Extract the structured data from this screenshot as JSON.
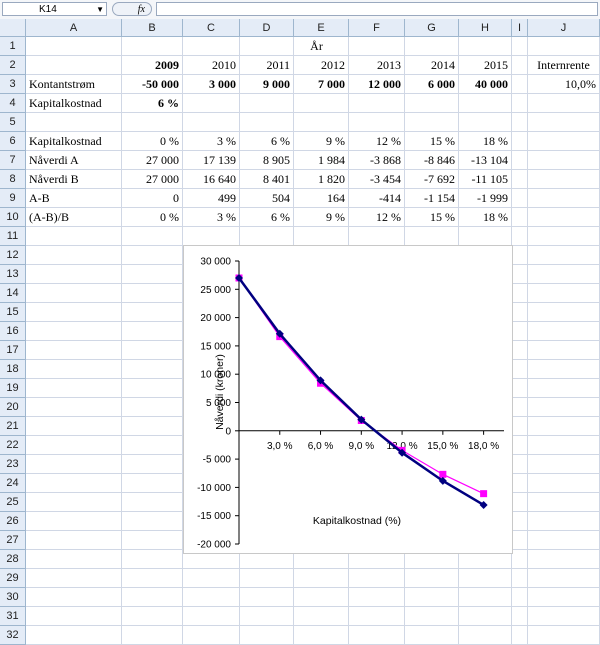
{
  "formula_bar": {
    "name_box": "K14",
    "fx": "fx",
    "formula": ""
  },
  "columns": [
    "A",
    "B",
    "C",
    "D",
    "E",
    "F",
    "G",
    "H",
    "I",
    "J"
  ],
  "rows": [
    "1",
    "2",
    "3",
    "4",
    "5",
    "6",
    "7",
    "8",
    "9",
    "10",
    "11",
    "12",
    "13",
    "14",
    "15",
    "16",
    "17",
    "18",
    "19",
    "20",
    "21",
    "22",
    "23",
    "24",
    "25",
    "26",
    "27",
    "28",
    "29",
    "30",
    "31",
    "32"
  ],
  "cells": {
    "aar": "År",
    "years": [
      "2009",
      "2010",
      "2011",
      "2012",
      "2013",
      "2014",
      "2015"
    ],
    "internrente_label": "Internrente",
    "internrente_value": "10,0%",
    "row3_label": "Kontantstrøm",
    "row3_values": [
      "-50 000",
      "3 000",
      "9 000",
      "7 000",
      "12 000",
      "6 000",
      "40 000"
    ],
    "row4_label": "Kapitalkostnad",
    "row4_value": "6 %",
    "row6_label": "Kapitalkostnad",
    "row6_values": [
      "0 %",
      "3 %",
      "6 %",
      "9 %",
      "12 %",
      "15 %",
      "18 %"
    ],
    "row7_label": "Nåverdi A",
    "row7_values": [
      "27 000",
      "17 139",
      "8 905",
      "1 984",
      "-3 868",
      "-8 846",
      "-13 104"
    ],
    "row8_label": "Nåverdi B",
    "row8_values": [
      "27 000",
      "16 640",
      "8 401",
      "1 820",
      "-3 454",
      "-7 692",
      "-11 105"
    ],
    "row9_label": "A-B",
    "row9_values": [
      "0",
      "499",
      "504",
      "164",
      "-414",
      "-1 154",
      "-1 999"
    ],
    "row10_label": "(A-B)/B",
    "row10_values": [
      "0 %",
      "3 %",
      "6 %",
      "9 %",
      "12 %",
      "15 %",
      "18 %"
    ]
  },
  "chart_data": {
    "type": "line",
    "x": [
      0,
      3,
      6,
      9,
      12,
      15,
      18
    ],
    "x_tick_labels": [
      "3,0 %",
      "6,0 %",
      "9,0 %",
      "12,0 %",
      "15,0 %",
      "18,0 %"
    ],
    "y_tick_labels": [
      "30 000",
      "25 000",
      "20 000",
      "15 000",
      "10 000",
      "5 000",
      "0",
      "-5 000",
      "-10 000",
      "-15 000",
      "-20 000"
    ],
    "ylim": [
      -20000,
      30000
    ],
    "xlim": [
      0,
      19.5
    ],
    "xlabel": "Kapitalkostnad (%)",
    "ylabel": "Nåverdi (kroner)",
    "grid": false,
    "series": [
      {
        "values": [
          27000,
          17139,
          8905,
          1984,
          -3868,
          -8846,
          -13104
        ],
        "color": "#000080",
        "marker": "diamond"
      },
      {
        "values": [
          27000,
          16640,
          8401,
          1820,
          -3454,
          -7692,
          -11105
        ],
        "color": "#ff00ff",
        "marker": "square"
      }
    ]
  }
}
